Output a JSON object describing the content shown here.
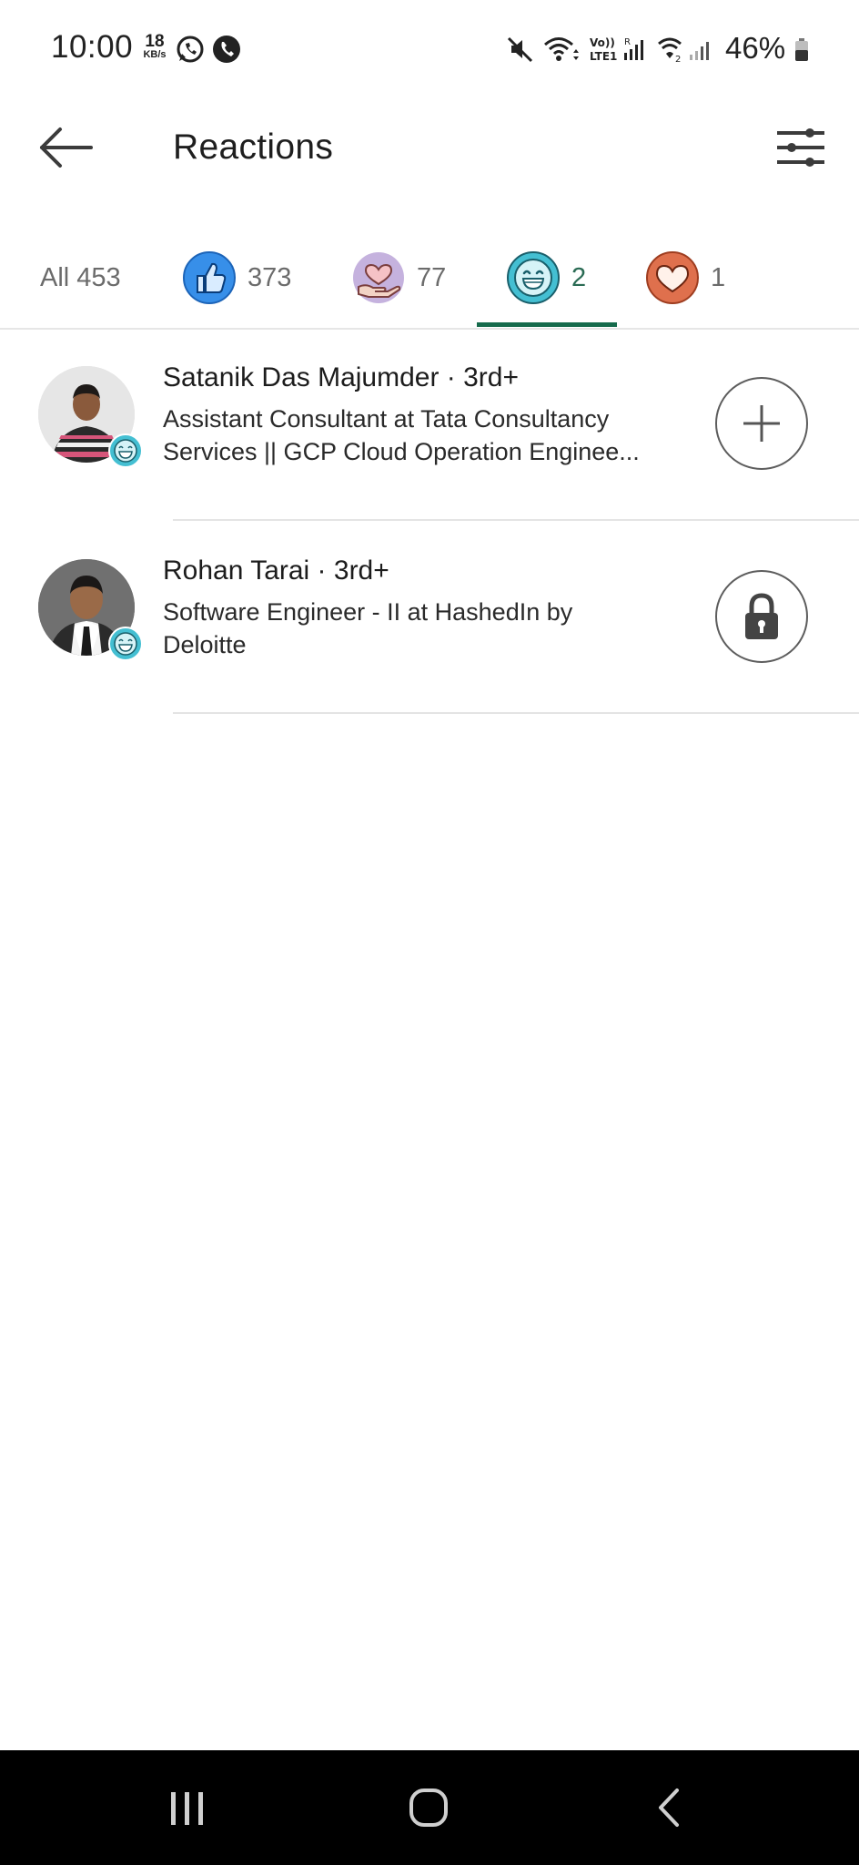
{
  "status_bar": {
    "time": "10:00",
    "net_speed_value": "18",
    "net_speed_unit": "KB/s",
    "battery_percent": "46%"
  },
  "header": {
    "title": "Reactions"
  },
  "tabs": [
    {
      "label": "All 453",
      "icon": null,
      "selected": false
    },
    {
      "label": "373",
      "icon": "like-icon",
      "icon_color": "#378fe9",
      "selected": false
    },
    {
      "label": "77",
      "icon": "support-icon",
      "icon_color": "#c5b2de",
      "selected": false
    },
    {
      "label": "2",
      "icon": "funny-icon",
      "icon_color": "#44bfd2",
      "selected": true
    },
    {
      "label": "1",
      "icon": "love-icon",
      "icon_color": "#df704d",
      "selected": false
    }
  ],
  "people": [
    {
      "name": "Satanik Das Majumder · 3rd+",
      "headline_line1": "Assistant Consultant at Tata Consultancy",
      "headline_line2": "Services || GCP Cloud Operation Enginee...",
      "action": "connect-plus",
      "reaction_badge": "funny-icon"
    },
    {
      "name": "Rohan Tarai · 3rd+",
      "headline_line1": "Software Engineer - II at HashedIn by",
      "headline_line2": "Deloitte",
      "action": "locked",
      "reaction_badge": "funny-icon"
    }
  ],
  "colors": {
    "accent_green": "#166b4c",
    "funny_teal": "#44bfd2",
    "like_blue": "#378fe9",
    "love_orange": "#df704d",
    "support_purple": "#c5b2de"
  }
}
